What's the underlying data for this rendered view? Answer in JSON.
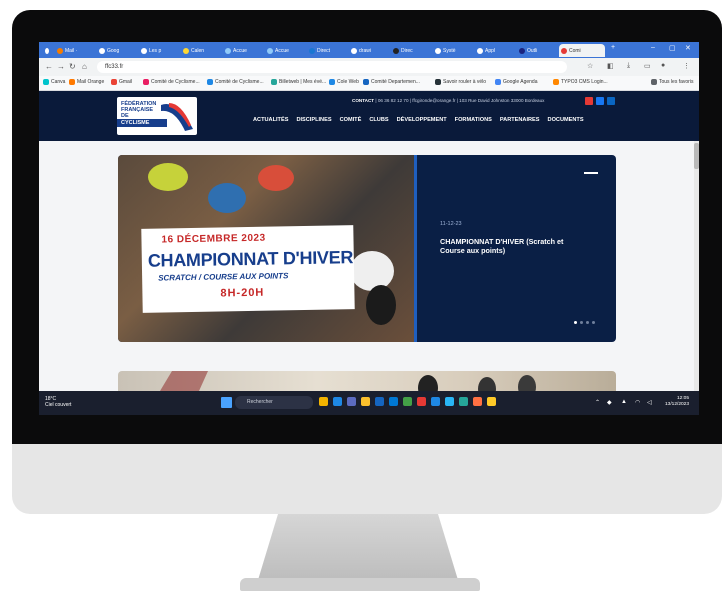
{
  "browser": {
    "tabs": [
      {
        "label": "Mail ·"
      },
      {
        "label": "Goog"
      },
      {
        "label": "Les p"
      },
      {
        "label": "Calen"
      },
      {
        "label": "Accue"
      },
      {
        "label": "Accue"
      },
      {
        "label": "Direct"
      },
      {
        "label": "drawi"
      },
      {
        "label": "Direc"
      },
      {
        "label": "Systè"
      },
      {
        "label": "Appl"
      },
      {
        "label": "Outli"
      },
      {
        "label": "Comi"
      }
    ],
    "new_tab": "+",
    "url": "ffc33.fr",
    "bookmarks": [
      {
        "label": "Canva"
      },
      {
        "label": "Mail Orange"
      },
      {
        "label": "Gmail"
      },
      {
        "label": "Comité de Cyclisme..."
      },
      {
        "label": "Comité de Cyclisme..."
      },
      {
        "label": "Billetweb | Mes évé..."
      },
      {
        "label": "Cole Web"
      },
      {
        "label": "Comité Departemen..."
      },
      {
        "label": "Savoir rouler à vélo"
      },
      {
        "label": "Google Agenda"
      },
      {
        "label": "TYPO3 CMS Login..."
      },
      {
        "label": "Tous les favoris"
      }
    ]
  },
  "site": {
    "logo_lines": [
      "FÉDÉRATION",
      "FRANÇAISE",
      "DE",
      "CYCLISME"
    ],
    "contact_label": "CONTACT",
    "contact_text": "| 06 36 82 12 70 | ffcgironde@orange.fr | 103 Rue David Johnston 33000 Bordeaux",
    "nav": [
      "ACTUALITÉS",
      "DISCIPLINES",
      "COMITÉ",
      "CLUBS",
      "DÉVELOPPEMENT",
      "FORMATIONS",
      "PARTENAIRES",
      "DOCUMENTS"
    ],
    "hero": {
      "poster_date": "16 DÉCEMBRE 2023",
      "poster_title": "CHAMPIONNAT D'HIVER",
      "poster_subtitle": "SCRATCH / COURSE AUX POINTS",
      "poster_time": "8H-20H",
      "panel_date": "11-12-23",
      "panel_title": "CHAMPIONNAT D'HIVER (Scratch et Course aux points)"
    }
  },
  "taskbar": {
    "weather_temp": "18°C",
    "weather_desc": "Ciel couvert",
    "search_placeholder": "Rechercher",
    "time": "12:05",
    "date": "13/12/2023"
  },
  "colors": {
    "tabstrip": "#3b74d6",
    "site_navy": "#0a1a3a",
    "hero_navy": "#0a1f45",
    "poster_red": "#c62828",
    "poster_blue": "#173e8c"
  }
}
